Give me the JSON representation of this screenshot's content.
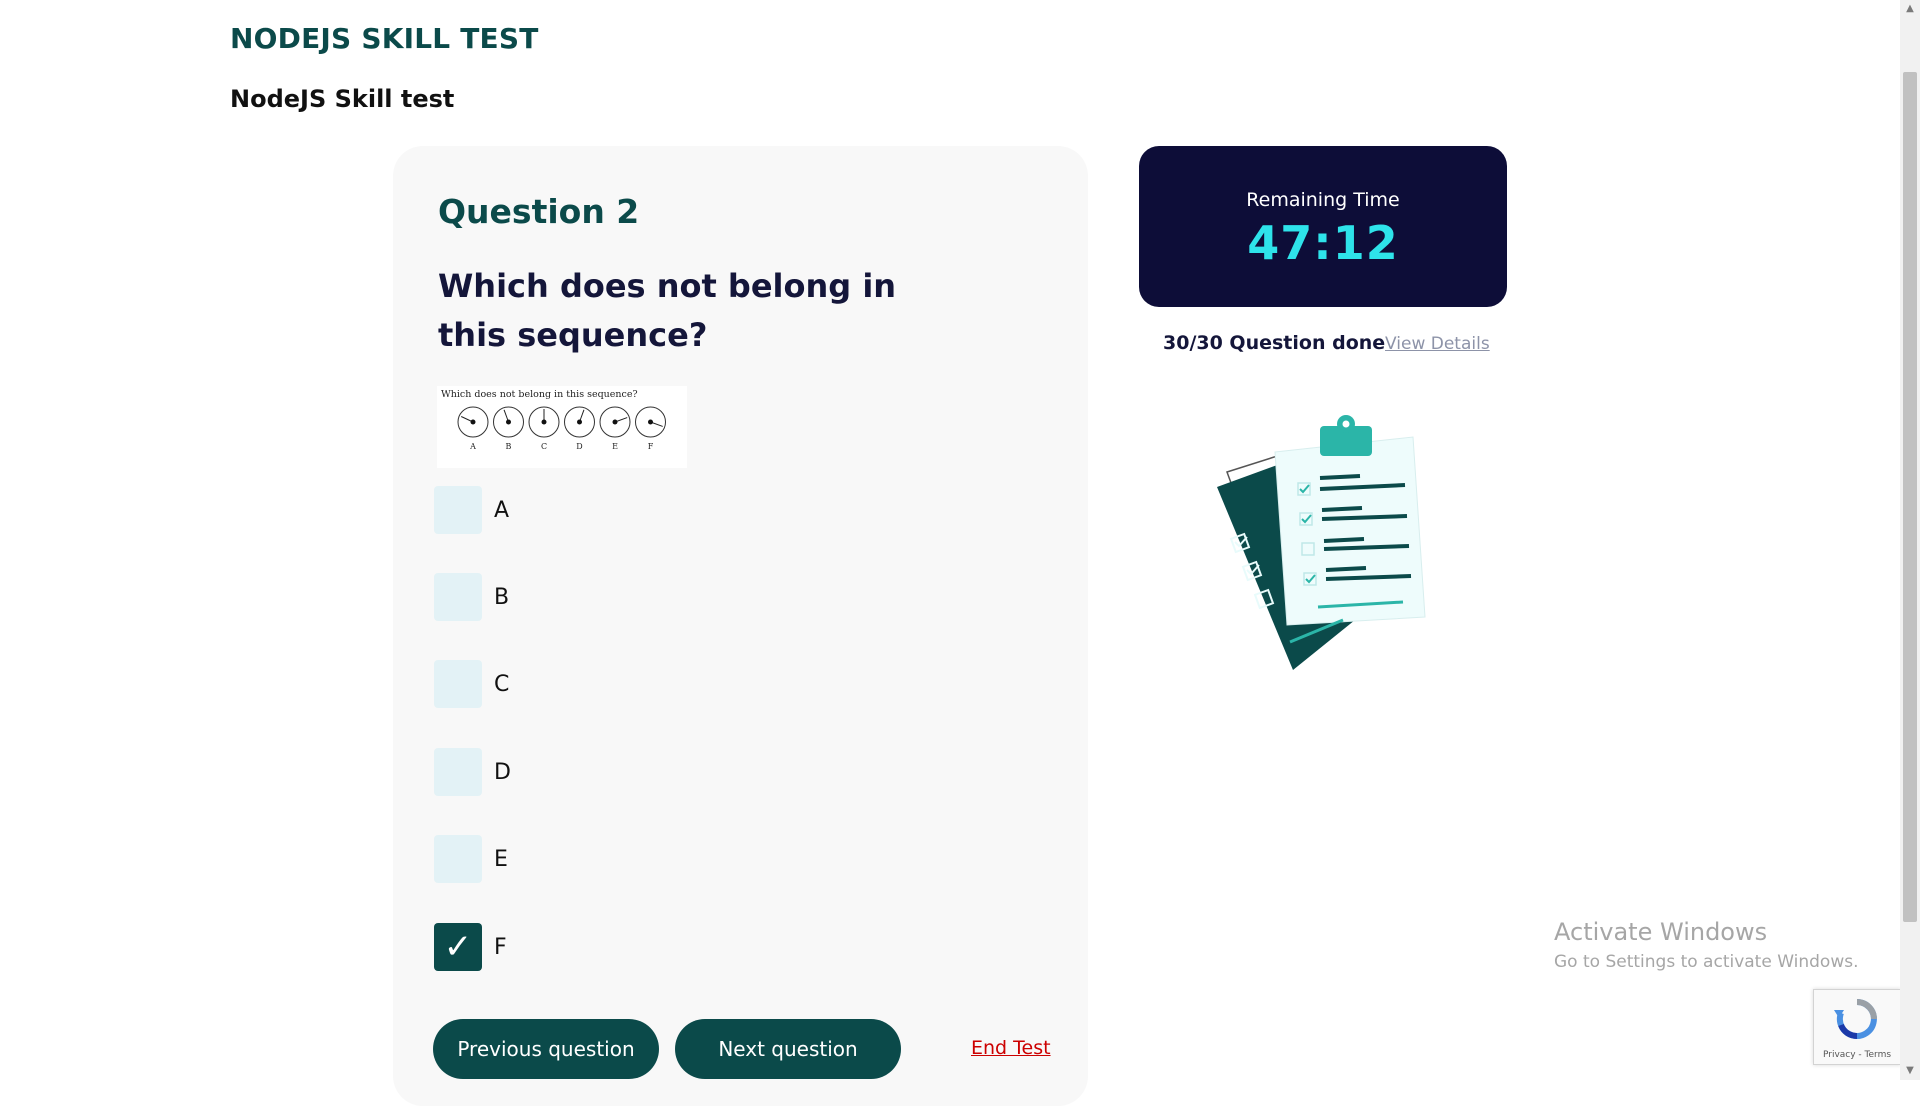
{
  "header": {
    "title": "NODEJS SKILL TEST",
    "subtitle": "NodeJS Skill test"
  },
  "question": {
    "number_label": "Question 2",
    "text": "Which does not belong in this sequence?",
    "image": {
      "caption": "Which does not belong in this sequence?",
      "labels": [
        "A",
        "B",
        "C",
        "D",
        "E",
        "F"
      ]
    },
    "options": [
      {
        "label": "A",
        "checked": false
      },
      {
        "label": "B",
        "checked": false
      },
      {
        "label": "C",
        "checked": false
      },
      {
        "label": "D",
        "checked": false
      },
      {
        "label": "E",
        "checked": false
      },
      {
        "label": "F",
        "checked": true
      }
    ]
  },
  "buttons": {
    "previous": "Previous question",
    "next": "Next question",
    "end": "End Test"
  },
  "timer": {
    "label": "Remaining Time",
    "value": "47:12"
  },
  "progress": {
    "text": "30/30 Question done",
    "details_link": "View Details"
  },
  "windows_overlay": {
    "title": "Activate Windows",
    "subtitle": "Go to Settings to activate Windows."
  },
  "recaptcha": {
    "text": "Privacy - Terms"
  },
  "colors": {
    "primary": "#0b4a4a",
    "timer_bg": "#0d0d38",
    "timer_text": "#2ee3ea",
    "end_test": "#cc0000",
    "option_bg": "#e3f2f6"
  }
}
